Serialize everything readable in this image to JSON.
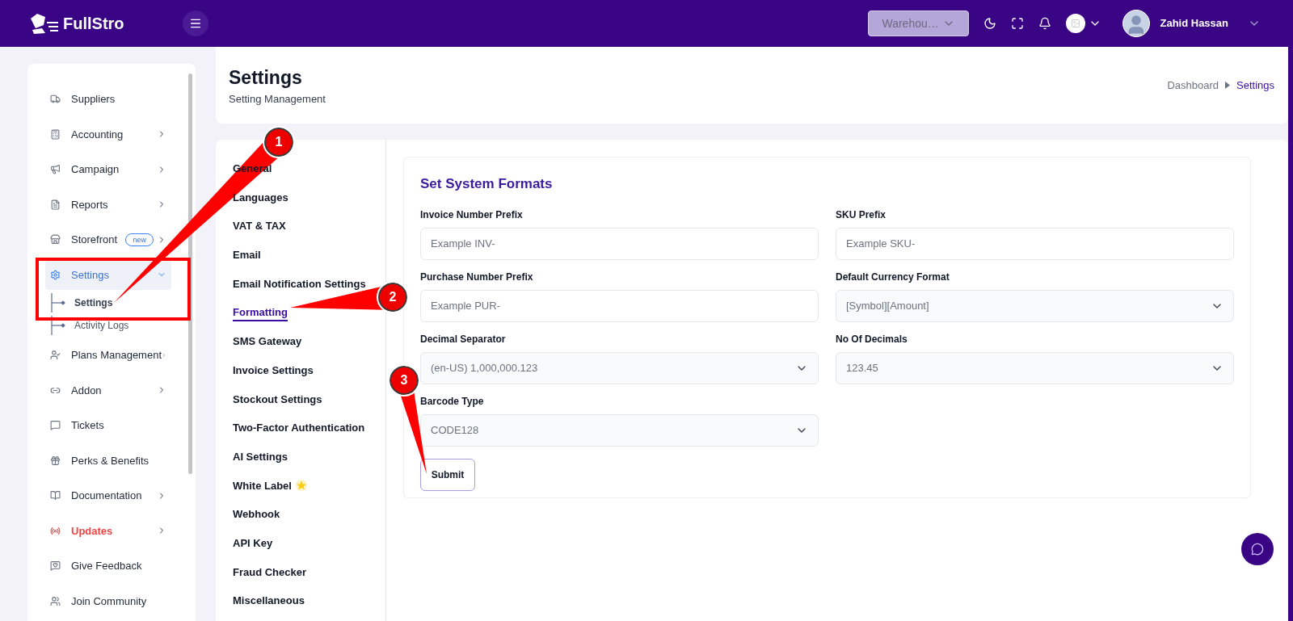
{
  "topbar": {
    "logo": "FullStro",
    "warehouse": "Warehou…",
    "user": "Zahid Hassan"
  },
  "sidebar": {
    "items": [
      {
        "label": "Suppliers",
        "expandable": false,
        "selected": false,
        "highlighted": false
      },
      {
        "label": "Accounting",
        "expandable": true,
        "selected": false,
        "highlighted": false
      },
      {
        "label": "Campaign",
        "expandable": true,
        "selected": false,
        "highlighted": false
      },
      {
        "label": "Reports",
        "expandable": true,
        "selected": false,
        "highlighted": false
      },
      {
        "label": "Storefront",
        "expandable": true,
        "selected": false,
        "highlighted": false,
        "badge": "new"
      },
      {
        "label": "Settings",
        "expandable": true,
        "selected": true,
        "highlighted": false,
        "expanded": true,
        "children": [
          {
            "label": "Settings",
            "selected": true
          },
          {
            "label": "Activity Logs",
            "selected": false
          }
        ]
      },
      {
        "label": "Plans Management",
        "expandable": true,
        "selected": false,
        "highlighted": false
      },
      {
        "label": "Addon",
        "expandable": true,
        "selected": false,
        "highlighted": false
      },
      {
        "label": "Tickets",
        "expandable": false,
        "selected": false,
        "highlighted": false
      },
      {
        "label": "Perks & Benefits",
        "expandable": false,
        "selected": false,
        "highlighted": false
      },
      {
        "label": "Documentation",
        "expandable": true,
        "selected": false,
        "highlighted": false
      },
      {
        "label": "Updates",
        "expandable": true,
        "selected": false,
        "highlighted": true
      },
      {
        "label": "Give Feedback",
        "expandable": false,
        "selected": false,
        "highlighted": false
      },
      {
        "label": "Join Community",
        "expandable": false,
        "selected": false,
        "highlighted": false
      }
    ]
  },
  "page_header": {
    "title": "Settings",
    "subtitle": "Setting Management",
    "breadcrumb": [
      {
        "label": "Dashboard",
        "selected": false
      },
      {
        "label": "Settings",
        "selected": true
      }
    ]
  },
  "settings_tabs": [
    {
      "label": "General",
      "selected": false
    },
    {
      "label": "Languages",
      "selected": false
    },
    {
      "label": "VAT & TAX",
      "selected": false
    },
    {
      "label": "Email",
      "selected": false
    },
    {
      "label": "Email Notification Settings",
      "selected": false
    },
    {
      "label": "Formatting",
      "selected": true
    },
    {
      "label": "SMS Gateway",
      "selected": false
    },
    {
      "label": "Invoice Settings",
      "selected": false
    },
    {
      "label": "Stockout Settings",
      "selected": false
    },
    {
      "label": "Two-Factor Authentication",
      "selected": false
    },
    {
      "label": "AI Settings",
      "selected": false
    },
    {
      "label": "White Label",
      "selected": false
    },
    {
      "label": "Webhook",
      "selected": false
    },
    {
      "label": "API Key",
      "selected": false
    },
    {
      "label": "Fraud Checker",
      "selected": false
    },
    {
      "label": "Miscellaneous",
      "selected": false
    }
  ],
  "form": {
    "title": "Set System Formats",
    "fields": [
      {
        "label": "Invoice Number Prefix",
        "kind": "input",
        "placeholder": "Example INV-"
      },
      {
        "label": "SKU Prefix",
        "kind": "input",
        "placeholder": "Example SKU-"
      },
      {
        "label": "Purchase Number Prefix",
        "kind": "input",
        "placeholder": "Example PUR-"
      },
      {
        "label": "Default Currency Format",
        "kind": "select",
        "value": "[Symbol][Amount]"
      },
      {
        "label": "Decimal Separator",
        "kind": "select",
        "value": "(en-US) 1,000,000.123"
      },
      {
        "label": "No Of Decimals",
        "kind": "select",
        "value": "123.45"
      },
      {
        "label": "Barcode Type",
        "kind": "select",
        "value": "CODE128"
      }
    ],
    "submit": "Submit"
  },
  "annotations": [
    {
      "label": "1"
    },
    {
      "label": "2"
    },
    {
      "label": "3"
    }
  ]
}
